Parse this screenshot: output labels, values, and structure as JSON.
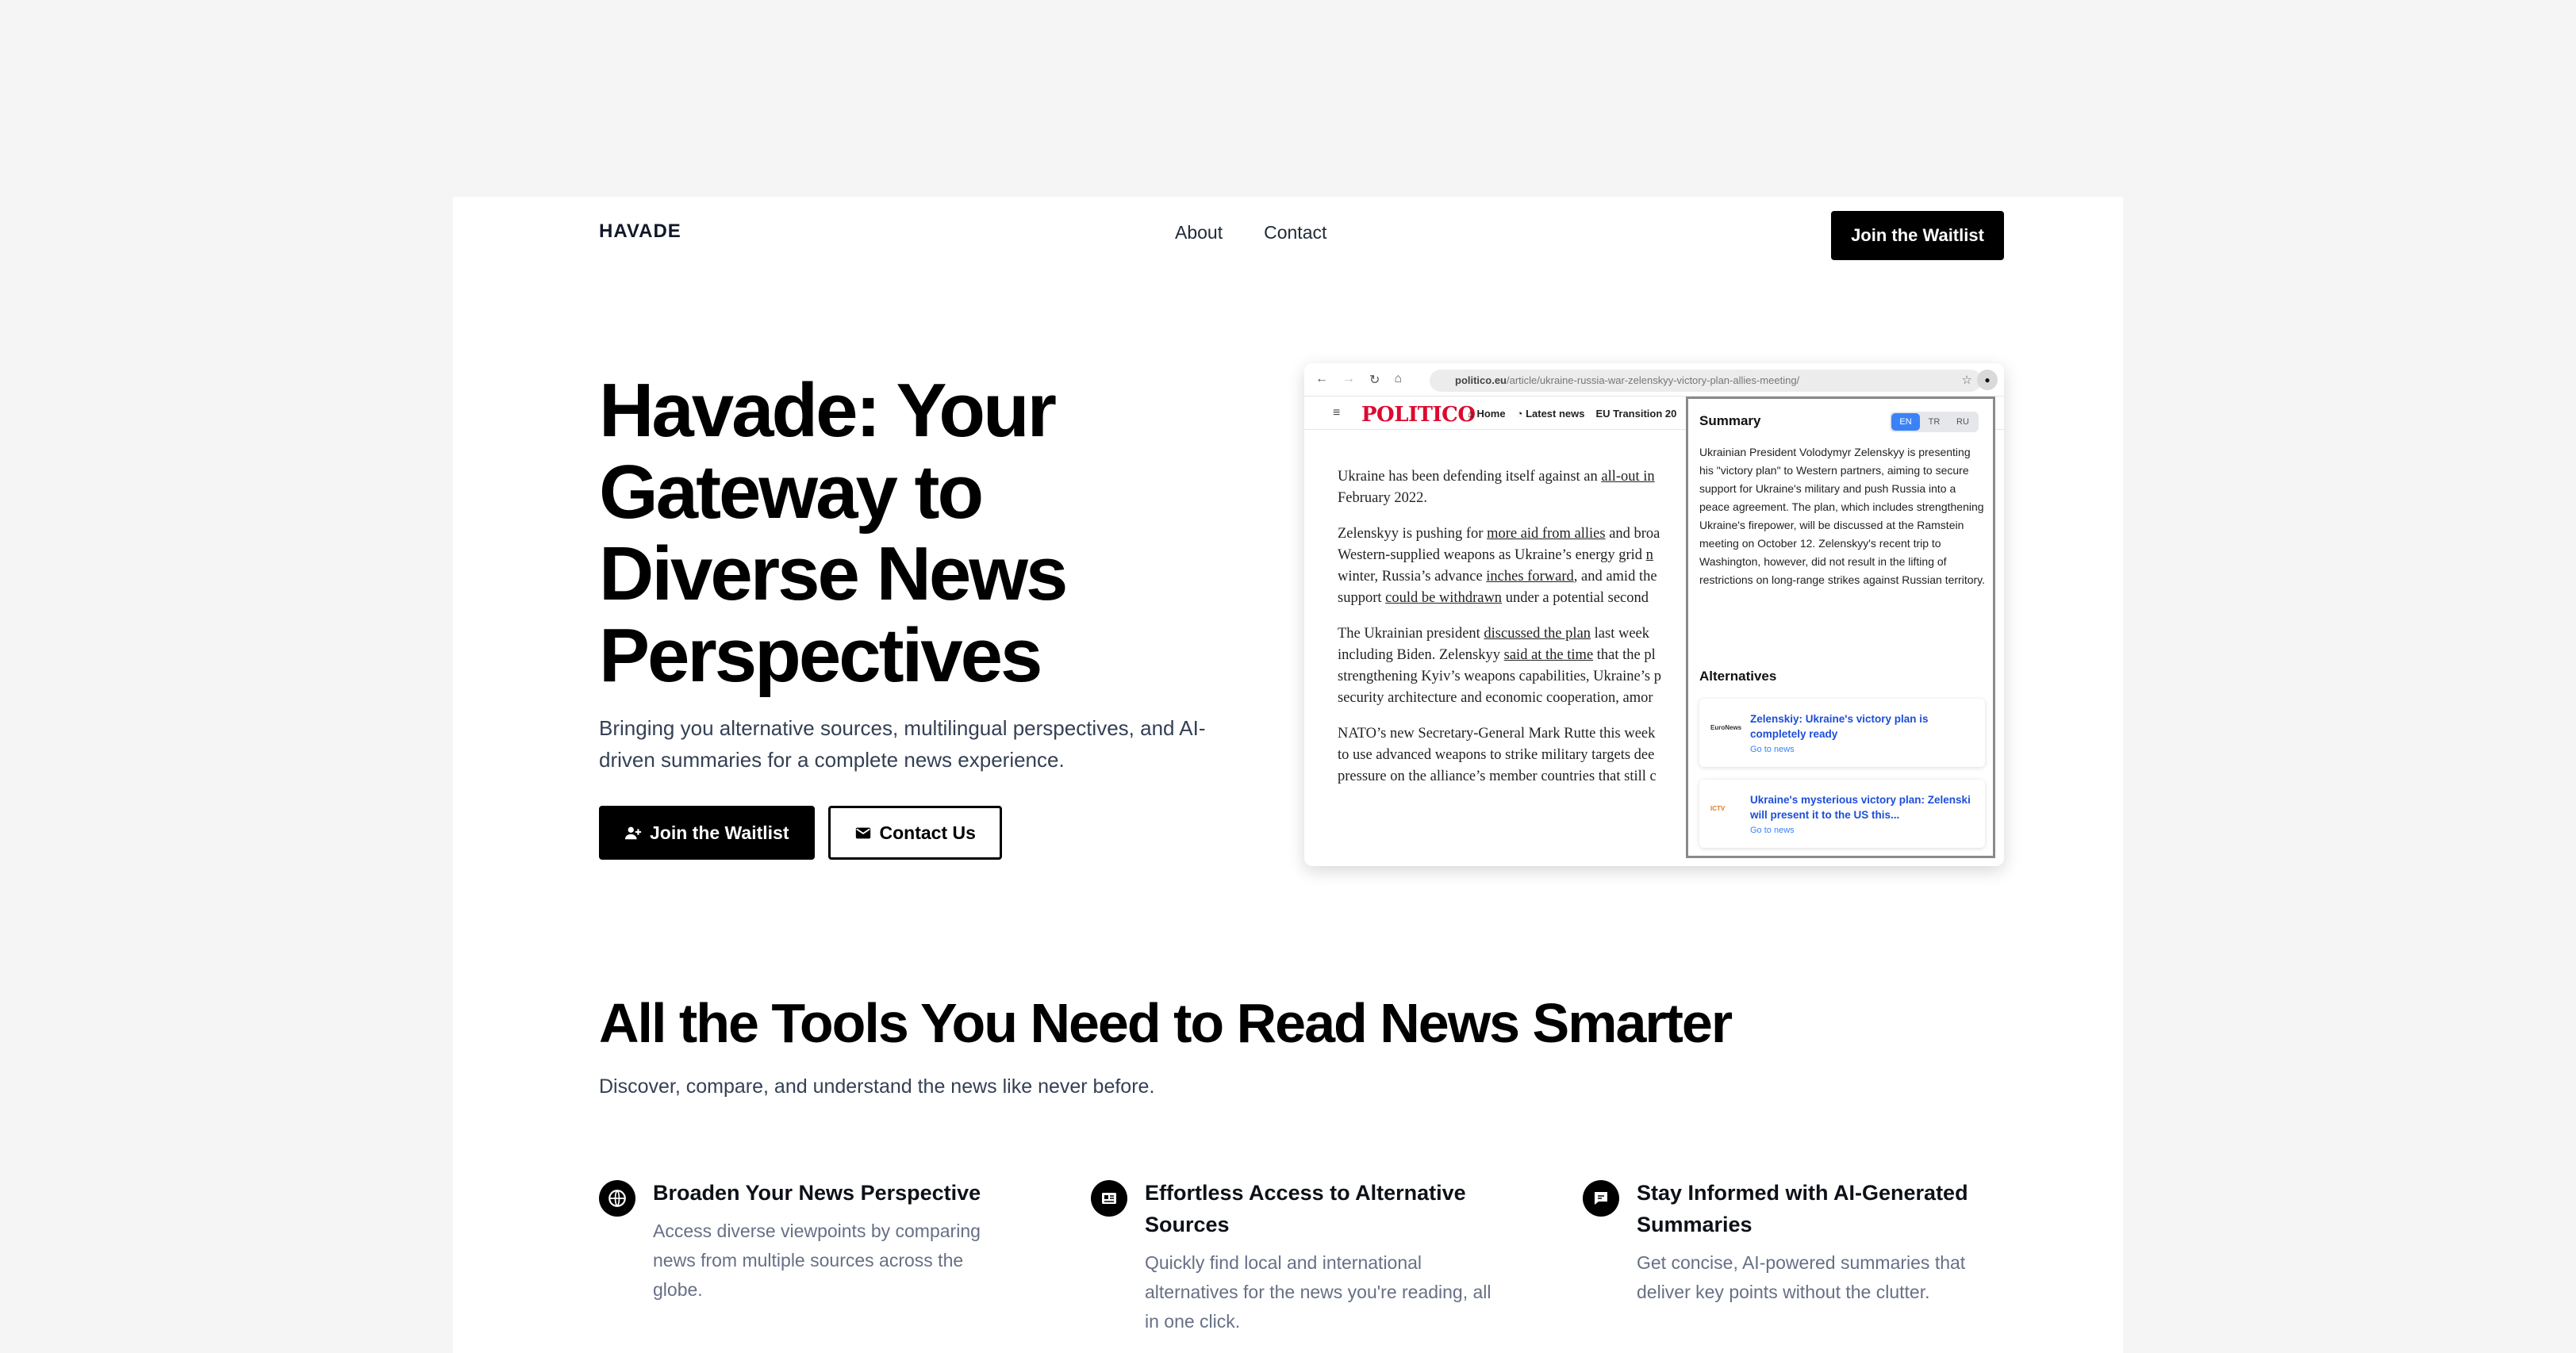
{
  "nav": {
    "logo": "HAVADE",
    "links": [
      "About",
      "Contact"
    ],
    "cta": "Join the Waitlist"
  },
  "hero": {
    "title_lines": [
      "Havade: Your",
      "Gateway to",
      "Diverse News",
      "Perspectives"
    ],
    "subtitle": "Bringing you alternative sources, multilingual perspectives, and AI-driven summaries for a complete news experience.",
    "primary_button": "Join the Waitlist",
    "secondary_button": "Contact Us"
  },
  "screenshot": {
    "url_host": "politico.eu",
    "url_path": "/article/ukraine-russia-war-zelenskyy-victory-plan-allies-meeting/",
    "site_logo": "POLITICO",
    "site_links": [
      "Home",
      "Latest news",
      "EU Transition 20"
    ],
    "article": [
      [
        "Ukraine has been defending itself against an ",
        "all-out in",
        ""
      ],
      [
        "February 2022.",
        "",
        ""
      ],
      [
        "Zelenskyy is pushing for ",
        "more aid from allies",
        " and broa"
      ],
      [
        "Western-supplied weapons as Ukraine’s energy grid ",
        "n",
        ""
      ],
      [
        "winter, Russia’s advance ",
        "inches forward",
        ", and amid the"
      ],
      [
        "support ",
        "could be withdrawn",
        " under a potential second"
      ],
      [
        "The Ukrainian president ",
        "discussed the plan",
        " last week"
      ],
      [
        "including Biden. Zelenskyy ",
        "said at the time",
        " that the pl"
      ],
      [
        "strengthening Kyiv’s weapons capabilities, Ukraine’s p",
        "",
        ""
      ],
      [
        "security architecture and economic cooperation, amor",
        "",
        ""
      ],
      [
        "NATO’s new Secretary-General Mark Rutte this week",
        "",
        ""
      ],
      [
        "to use advanced weapons to strike military targets dee",
        "",
        ""
      ],
      [
        "pressure on the alliance’s member countries that still c",
        "",
        ""
      ]
    ],
    "panel": {
      "summary_title": "Summary",
      "languages": [
        "EN",
        "TR",
        "RU"
      ],
      "active_language": "EN",
      "summary_text": "Ukrainian President Volodymyr Zelenskyy is presenting his \"victory plan\" to Western partners, aiming to secure support for Ukraine's military and push Russia into a peace agreement. The plan, which includes strengthening Ukraine's firepower, will be discussed at the Ramstein meeting on October 12. Zelenskyy's recent trip to Washington, however, did not result in the lifting of restrictions on long-range strikes against Russian territory.",
      "alternatives_title": "Alternatives",
      "alternatives": [
        {
          "source": "EuroNews",
          "headline": "Zelenskiy: Ukraine's victory plan is completely ready",
          "link": "Go to news"
        },
        {
          "source": "ICTV",
          "headline": "Ukraine's mysterious victory plan: Zelenski will present it to the US this...",
          "link": "Go to news"
        }
      ]
    }
  },
  "features_section": {
    "title": "All the Tools You Need to Read News Smarter",
    "subtitle": "Discover, compare, and understand the news like never before.",
    "items": [
      {
        "icon": "globe-icon",
        "title": "Broaden Your News Perspective",
        "description": "Access diverse viewpoints by comparing news from multiple sources across the globe."
      },
      {
        "icon": "newspaper-icon",
        "title": "Effortless Access to Alternative Sources",
        "description": "Quickly find local and international alternatives for the news you're reading, all in one click."
      },
      {
        "icon": "chat-icon",
        "title": "Stay Informed with AI-Generated Summaries",
        "description": "Get concise, AI-powered summaries that deliver key points without the clutter."
      }
    ]
  },
  "colors": {
    "background": "#f4f5f4",
    "card": "#ffffff",
    "primary": "#000000",
    "accent_blue": "#3b82f6",
    "politico_red": "#dc0a2f"
  }
}
